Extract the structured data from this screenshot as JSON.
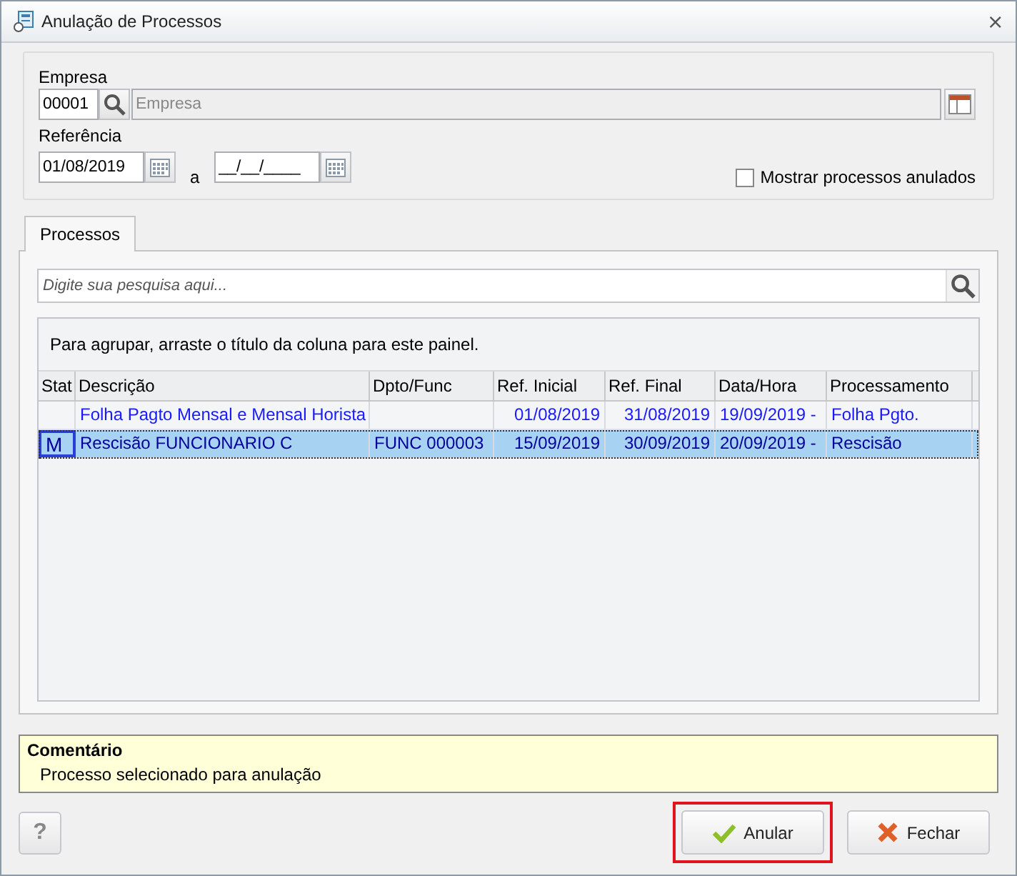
{
  "window": {
    "title": "Anulação de Processos",
    "close": "⨯"
  },
  "filters": {
    "empresa_label": "Empresa",
    "empresa_code": "00001",
    "empresa_name_placeholder": "Empresa",
    "referencia_label": "Referência",
    "date_from": "01/08/2019",
    "separator": "a",
    "date_to": "__/__/____",
    "show_annulled": {
      "label": "Mostrar processos anulados",
      "checked": false
    }
  },
  "tabs": [
    {
      "label": "Processos",
      "selected": true
    }
  ],
  "search": {
    "placeholder": "Digite sua pesquisa aqui..."
  },
  "grid": {
    "group_hint": "Para agrupar, arraste o título da coluna para este painel.",
    "columns": [
      "Stat",
      "Descrição",
      "Dpto/Func",
      "Ref. Inicial",
      "Ref. Final",
      "Data/Hora",
      "Processamento"
    ],
    "rows": [
      {
        "cells": [
          "",
          "Folha Pagto Mensal e Mensal Horista",
          "",
          "01/08/2019",
          "31/08/2019",
          "19/09/2019  -",
          "Folha Pgto."
        ],
        "selected": false
      },
      {
        "cells": [
          "M",
          "Rescisão FUNCIONARIO C",
          "FUNC 000003",
          "15/09/2019",
          "30/09/2019",
          "20/09/2019  -",
          "Rescisão"
        ],
        "selected": true
      }
    ]
  },
  "comment": {
    "title": "Comentário",
    "text": "Processo selecionado para anulação"
  },
  "buttons": [
    {
      "kind": "help",
      "label": "?"
    },
    {
      "kind": "confirm",
      "label": "Anular",
      "highlighted": true
    },
    {
      "kind": "close",
      "label": "Fechar"
    }
  ]
}
